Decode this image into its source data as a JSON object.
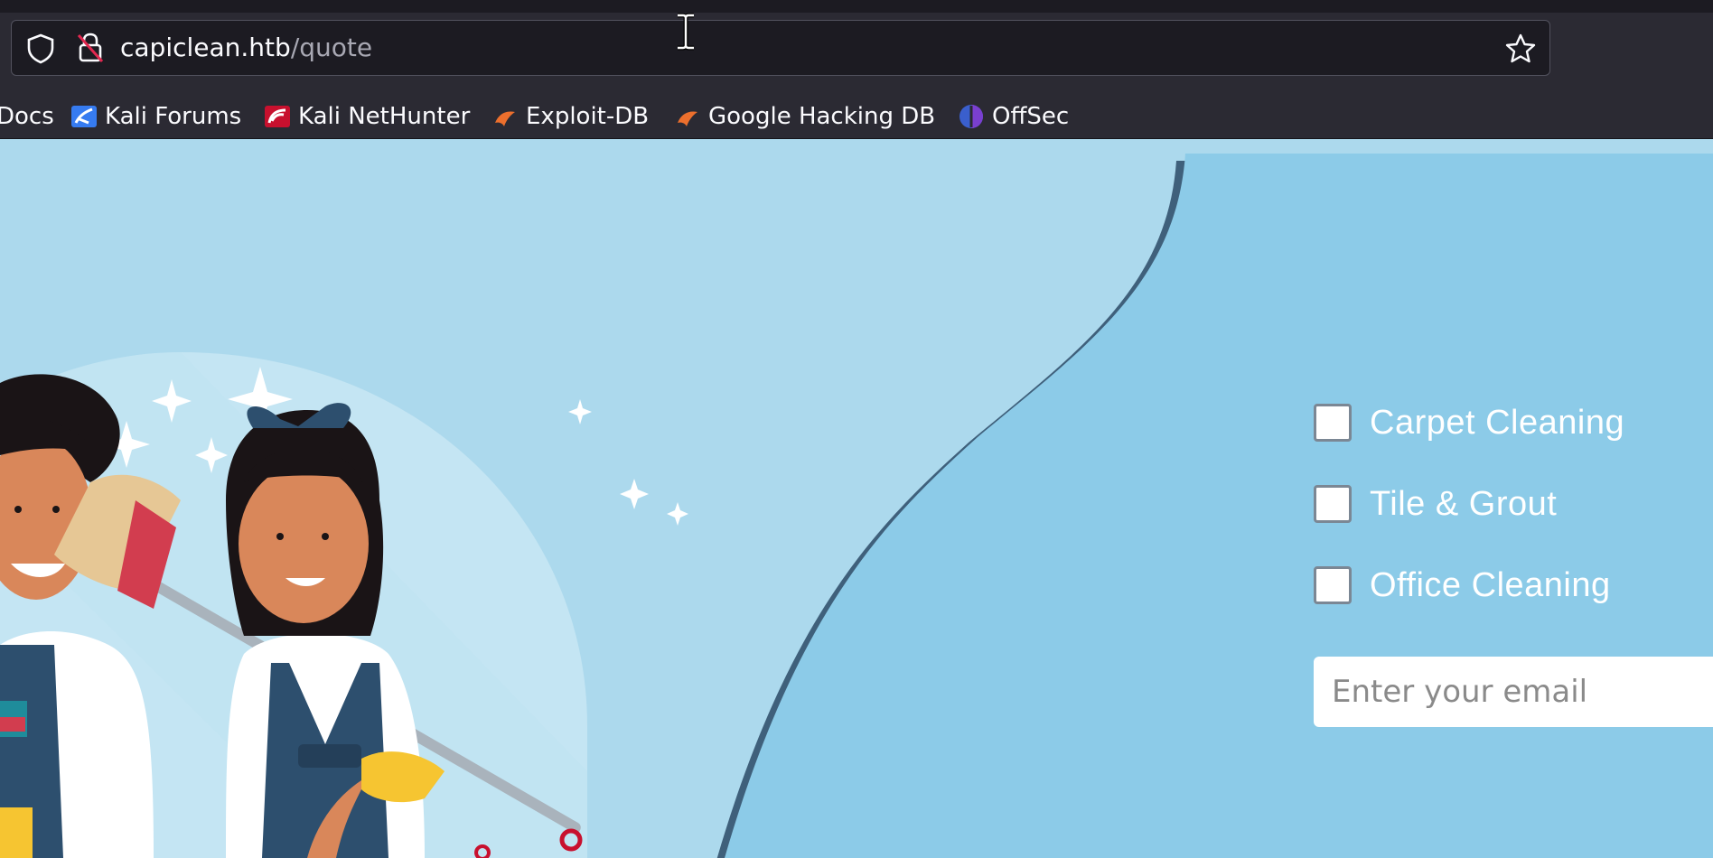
{
  "browser": {
    "url_host": "capiclean.htb",
    "url_path": "/quote",
    "icons": {
      "shield": "shield-icon",
      "lock": "lock-insecure-icon",
      "star": "bookmark-star-icon"
    }
  },
  "bookmarks": [
    {
      "label": "Docs",
      "icon": "kali-docs-icon"
    },
    {
      "label": "Kali Forums",
      "icon": "kali-forums-icon"
    },
    {
      "label": "Kali NetHunter",
      "icon": "kali-nethunter-icon"
    },
    {
      "label": "Exploit-DB",
      "icon": "exploit-db-icon"
    },
    {
      "label": "Google Hacking DB",
      "icon": "ghdb-icon"
    },
    {
      "label": "OffSec",
      "icon": "offsec-icon"
    }
  ],
  "quote_form": {
    "services": [
      {
        "label": "Carpet Cleaning",
        "checked": false
      },
      {
        "label": "Tile & Grout",
        "checked": false
      },
      {
        "label": "Office Cleaning",
        "checked": false
      }
    ],
    "email_placeholder": "Enter your email",
    "email_value": ""
  },
  "colors": {
    "background_light": "#acd9ed",
    "background_dark": "#8ccbe8",
    "wave_shadow": "#2b4a66"
  }
}
